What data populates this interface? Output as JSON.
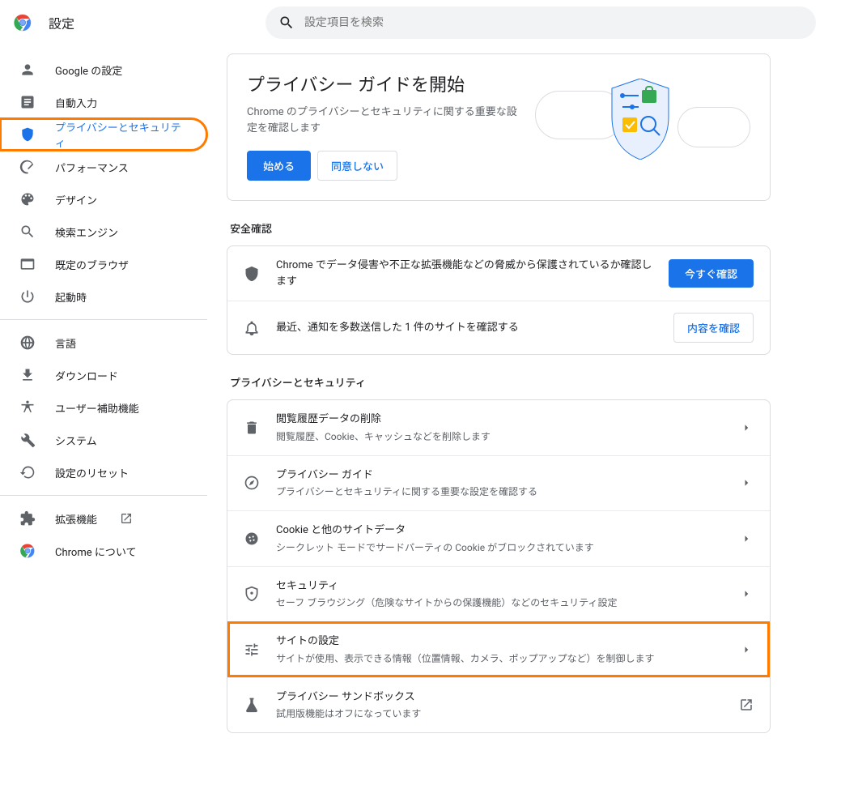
{
  "header": {
    "title": "設定",
    "search_placeholder": "設定項目を検索"
  },
  "sidebar": {
    "items": [
      {
        "label": "Google の設定",
        "icon": "person"
      },
      {
        "label": "自動入力",
        "icon": "autofill"
      },
      {
        "label": "プライバシーとセキュリティ",
        "icon": "shield",
        "active": true,
        "highlighted": true
      },
      {
        "label": "パフォーマンス",
        "icon": "speed"
      },
      {
        "label": "デザイン",
        "icon": "palette"
      },
      {
        "label": "検索エンジン",
        "icon": "search"
      },
      {
        "label": "既定のブラウザ",
        "icon": "browser"
      },
      {
        "label": "起動時",
        "icon": "power"
      }
    ],
    "items2": [
      {
        "label": "言語",
        "icon": "globe"
      },
      {
        "label": "ダウンロード",
        "icon": "download"
      },
      {
        "label": "ユーザー補助機能",
        "icon": "accessibility"
      },
      {
        "label": "システム",
        "icon": "wrench"
      },
      {
        "label": "設定のリセット",
        "icon": "reset"
      }
    ],
    "items3": [
      {
        "label": "拡張機能",
        "icon": "extension",
        "external": true
      },
      {
        "label": "Chrome について",
        "icon": "chrome"
      }
    ]
  },
  "main": {
    "guide": {
      "title": "プライバシー ガイドを開始",
      "desc": "Chrome のプライバシーとセキュリティに関する重要な設定を確認します",
      "start": "始める",
      "decline": "同意しない"
    },
    "safety_check_title": "安全確認",
    "safety_rows": [
      {
        "icon": "verified",
        "text": "Chrome でデータ侵害や不正な拡張機能などの脅威から保護されているか確認します",
        "action_label": "今すぐ確認",
        "action_style": "primary"
      },
      {
        "icon": "bell",
        "text": "最近、通知を多数送信した 1 件のサイトを確認する",
        "action_label": "内容を確認",
        "action_style": "secondary"
      }
    ],
    "privacy_title": "プライバシーとセキュリティ",
    "privacy_rows": [
      {
        "icon": "trash",
        "title": "閲覧履歴データの削除",
        "sub": "閲覧履歴、Cookie、キャッシュなどを削除します",
        "end": "chevron"
      },
      {
        "icon": "compass",
        "title": "プライバシー ガイド",
        "sub": "プライバシーとセキュリティに関する重要な設定を確認する",
        "end": "chevron"
      },
      {
        "icon": "cookie",
        "title": "Cookie と他のサイトデータ",
        "sub": "シークレット モードでサードパーティの Cookie がブロックされています",
        "end": "chevron"
      },
      {
        "icon": "security",
        "title": "セキュリティ",
        "sub": "セーフ ブラウジング（危険なサイトからの保護機能）などのセキュリティ設定",
        "end": "chevron"
      },
      {
        "icon": "tune",
        "title": "サイトの設定",
        "sub": "サイトが使用、表示できる情報（位置情報、カメラ、ポップアップなど）を制御します",
        "end": "chevron",
        "highlighted": true
      },
      {
        "icon": "flask",
        "title": "プライバシー サンドボックス",
        "sub": "試用版機能はオフになっています",
        "end": "external"
      }
    ]
  }
}
